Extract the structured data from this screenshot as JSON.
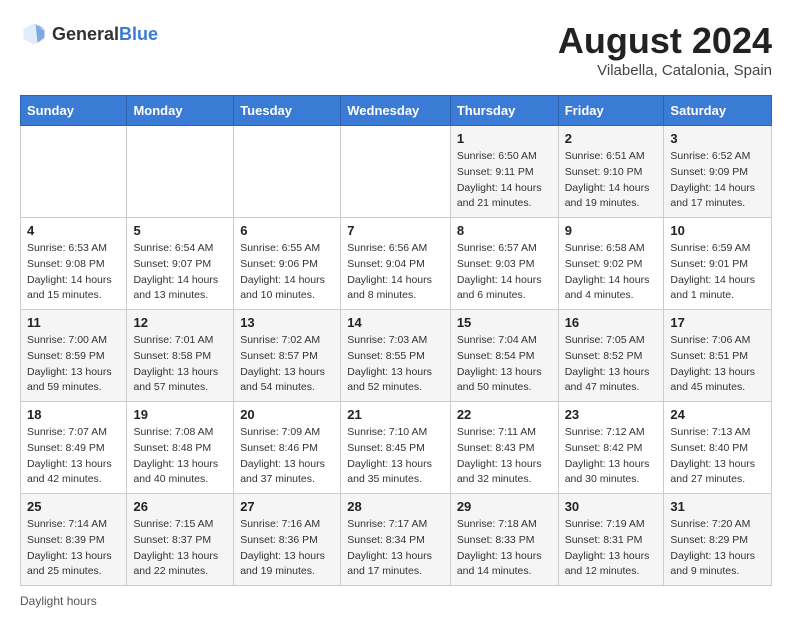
{
  "header": {
    "logo_general": "General",
    "logo_blue": "Blue",
    "month_year": "August 2024",
    "location": "Vilabella, Catalonia, Spain"
  },
  "days_of_week": [
    "Sunday",
    "Monday",
    "Tuesday",
    "Wednesday",
    "Thursday",
    "Friday",
    "Saturday"
  ],
  "footer": {
    "note": "Daylight hours"
  },
  "weeks": [
    {
      "days": [
        {
          "num": "",
          "info": ""
        },
        {
          "num": "",
          "info": ""
        },
        {
          "num": "",
          "info": ""
        },
        {
          "num": "",
          "info": ""
        },
        {
          "num": "1",
          "info": "Sunrise: 6:50 AM\nSunset: 9:11 PM\nDaylight: 14 hours\nand 21 minutes."
        },
        {
          "num": "2",
          "info": "Sunrise: 6:51 AM\nSunset: 9:10 PM\nDaylight: 14 hours\nand 19 minutes."
        },
        {
          "num": "3",
          "info": "Sunrise: 6:52 AM\nSunset: 9:09 PM\nDaylight: 14 hours\nand 17 minutes."
        }
      ]
    },
    {
      "days": [
        {
          "num": "4",
          "info": "Sunrise: 6:53 AM\nSunset: 9:08 PM\nDaylight: 14 hours\nand 15 minutes."
        },
        {
          "num": "5",
          "info": "Sunrise: 6:54 AM\nSunset: 9:07 PM\nDaylight: 14 hours\nand 13 minutes."
        },
        {
          "num": "6",
          "info": "Sunrise: 6:55 AM\nSunset: 9:06 PM\nDaylight: 14 hours\nand 10 minutes."
        },
        {
          "num": "7",
          "info": "Sunrise: 6:56 AM\nSunset: 9:04 PM\nDaylight: 14 hours\nand 8 minutes."
        },
        {
          "num": "8",
          "info": "Sunrise: 6:57 AM\nSunset: 9:03 PM\nDaylight: 14 hours\nand 6 minutes."
        },
        {
          "num": "9",
          "info": "Sunrise: 6:58 AM\nSunset: 9:02 PM\nDaylight: 14 hours\nand 4 minutes."
        },
        {
          "num": "10",
          "info": "Sunrise: 6:59 AM\nSunset: 9:01 PM\nDaylight: 14 hours\nand 1 minute."
        }
      ]
    },
    {
      "days": [
        {
          "num": "11",
          "info": "Sunrise: 7:00 AM\nSunset: 8:59 PM\nDaylight: 13 hours\nand 59 minutes."
        },
        {
          "num": "12",
          "info": "Sunrise: 7:01 AM\nSunset: 8:58 PM\nDaylight: 13 hours\nand 57 minutes."
        },
        {
          "num": "13",
          "info": "Sunrise: 7:02 AM\nSunset: 8:57 PM\nDaylight: 13 hours\nand 54 minutes."
        },
        {
          "num": "14",
          "info": "Sunrise: 7:03 AM\nSunset: 8:55 PM\nDaylight: 13 hours\nand 52 minutes."
        },
        {
          "num": "15",
          "info": "Sunrise: 7:04 AM\nSunset: 8:54 PM\nDaylight: 13 hours\nand 50 minutes."
        },
        {
          "num": "16",
          "info": "Sunrise: 7:05 AM\nSunset: 8:52 PM\nDaylight: 13 hours\nand 47 minutes."
        },
        {
          "num": "17",
          "info": "Sunrise: 7:06 AM\nSunset: 8:51 PM\nDaylight: 13 hours\nand 45 minutes."
        }
      ]
    },
    {
      "days": [
        {
          "num": "18",
          "info": "Sunrise: 7:07 AM\nSunset: 8:49 PM\nDaylight: 13 hours\nand 42 minutes."
        },
        {
          "num": "19",
          "info": "Sunrise: 7:08 AM\nSunset: 8:48 PM\nDaylight: 13 hours\nand 40 minutes."
        },
        {
          "num": "20",
          "info": "Sunrise: 7:09 AM\nSunset: 8:46 PM\nDaylight: 13 hours\nand 37 minutes."
        },
        {
          "num": "21",
          "info": "Sunrise: 7:10 AM\nSunset: 8:45 PM\nDaylight: 13 hours\nand 35 minutes."
        },
        {
          "num": "22",
          "info": "Sunrise: 7:11 AM\nSunset: 8:43 PM\nDaylight: 13 hours\nand 32 minutes."
        },
        {
          "num": "23",
          "info": "Sunrise: 7:12 AM\nSunset: 8:42 PM\nDaylight: 13 hours\nand 30 minutes."
        },
        {
          "num": "24",
          "info": "Sunrise: 7:13 AM\nSunset: 8:40 PM\nDaylight: 13 hours\nand 27 minutes."
        }
      ]
    },
    {
      "days": [
        {
          "num": "25",
          "info": "Sunrise: 7:14 AM\nSunset: 8:39 PM\nDaylight: 13 hours\nand 25 minutes."
        },
        {
          "num": "26",
          "info": "Sunrise: 7:15 AM\nSunset: 8:37 PM\nDaylight: 13 hours\nand 22 minutes."
        },
        {
          "num": "27",
          "info": "Sunrise: 7:16 AM\nSunset: 8:36 PM\nDaylight: 13 hours\nand 19 minutes."
        },
        {
          "num": "28",
          "info": "Sunrise: 7:17 AM\nSunset: 8:34 PM\nDaylight: 13 hours\nand 17 minutes."
        },
        {
          "num": "29",
          "info": "Sunrise: 7:18 AM\nSunset: 8:33 PM\nDaylight: 13 hours\nand 14 minutes."
        },
        {
          "num": "30",
          "info": "Sunrise: 7:19 AM\nSunset: 8:31 PM\nDaylight: 13 hours\nand 12 minutes."
        },
        {
          "num": "31",
          "info": "Sunrise: 7:20 AM\nSunset: 8:29 PM\nDaylight: 13 hours\nand 9 minutes."
        }
      ]
    }
  ]
}
